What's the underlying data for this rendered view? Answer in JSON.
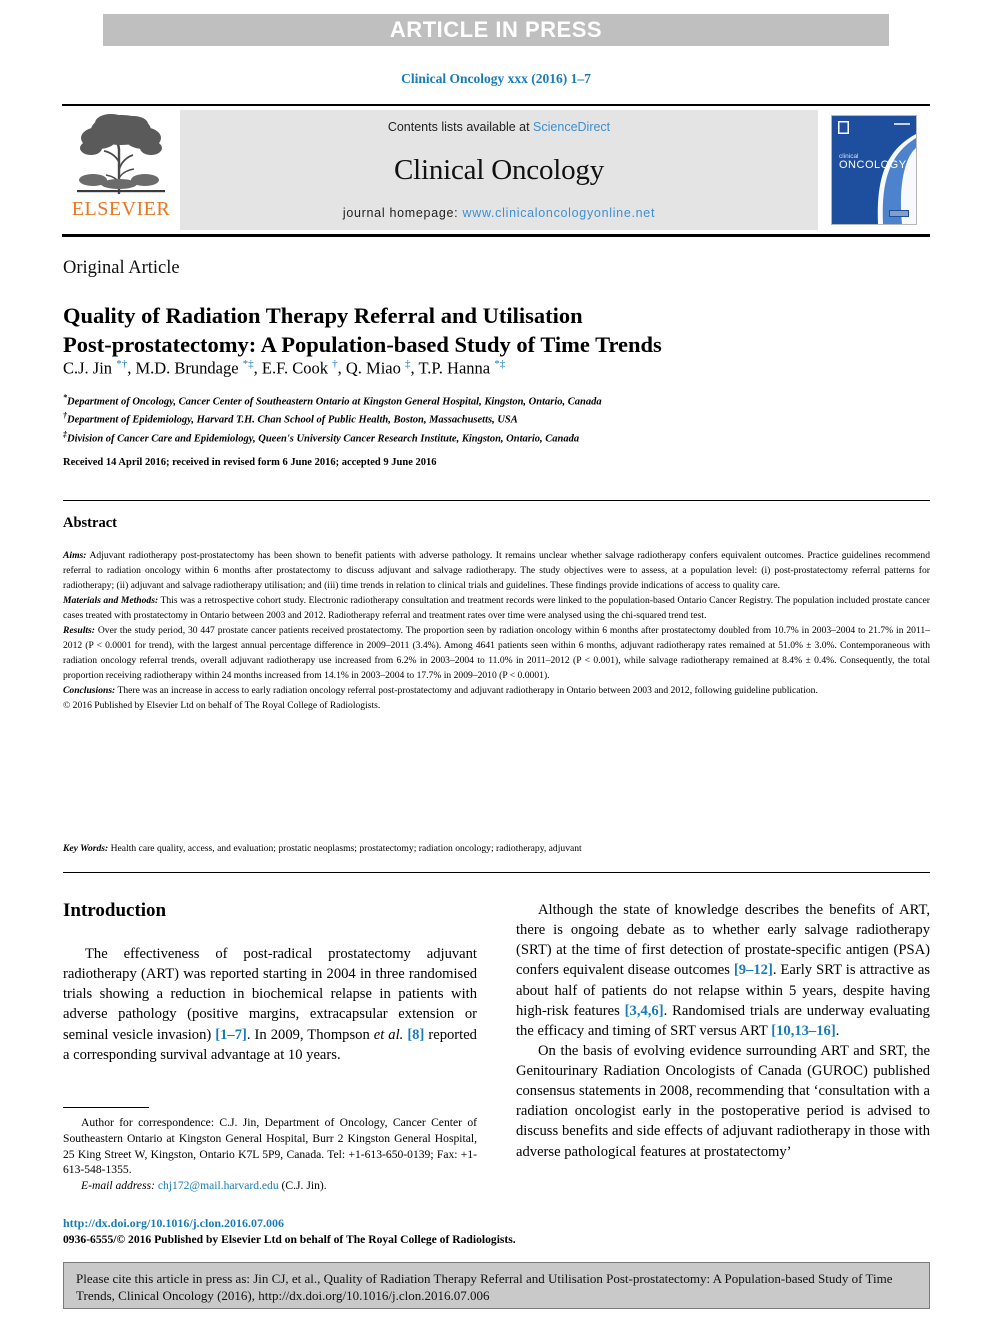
{
  "banner": {
    "text": "ARTICLE IN PRESS"
  },
  "citation": {
    "line": "Clinical Oncology xxx (2016) 1–7"
  },
  "masthead": {
    "publisher_word": "ELSEVIER",
    "contents_prefix": "Contents lists available at ",
    "contents_link": "ScienceDirect",
    "journal_name": "Clinical Oncology",
    "homepage_prefix": "journal homepage: ",
    "homepage_url": "www.clinicaloncologyonline.net",
    "cover_title_small": "clinical",
    "cover_title_large": "ONCOLOGY"
  },
  "article": {
    "type": "Original Article",
    "title_line1": "Quality of Radiation Therapy Referral and Utilisation",
    "title_line2": "Post-prostatectomy: A Population-based Study of Time Trends",
    "authors_html": "C.J. Jin <sup>*†</sup>, M.D. Brundage <sup>*‡</sup>, E.F. Cook <sup>†</sup>, Q. Miao <sup>‡</sup>, T.P. Hanna <sup>*‡</sup>",
    "affiliations": [
      {
        "marker": "*",
        "text": "Department of Oncology, Cancer Center of Southeastern Ontario at Kingston General Hospital, Kingston, Ontario, Canada"
      },
      {
        "marker": "†",
        "text": "Department of Epidemiology, Harvard T.H. Chan School of Public Health, Boston, Massachusetts, USA"
      },
      {
        "marker": "‡",
        "text": "Division of Cancer Care and Epidemiology, Queen's University Cancer Research Institute, Kingston, Ontario, Canada"
      }
    ],
    "history": "Received 14 April 2016; received in revised form 6 June 2016; accepted 9 June 2016"
  },
  "abstract": {
    "heading": "Abstract",
    "aims_label": "Aims:",
    "aims_text": " Adjuvant radiotherapy post-prostatectomy has been shown to benefit patients with adverse pathology. It remains unclear whether salvage radiotherapy confers equivalent outcomes. Practice guidelines recommend referral to radiation oncology within 6 months after prostatectomy to discuss adjuvant and salvage radiotherapy. The study objectives were to assess, at a population level: (i) post-prostatectomy referral patterns for radiotherapy; (ii) adjuvant and salvage radiotherapy utilisation; and (iii) time trends in relation to clinical trials and guidelines. These findings provide indications of access to quality care.",
    "methods_label": "Materials and Methods:",
    "methods_text": " This was a retrospective cohort study. Electronic radiotherapy consultation and treatment records were linked to the population-based Ontario Cancer Registry. The population included prostate cancer cases treated with prostatectomy in Ontario between 2003 and 2012. Radiotherapy referral and treatment rates over time were analysed using the chi-squared trend test.",
    "results_label": "Results:",
    "results_text": " Over the study period, 30 447 prostate cancer patients received prostatectomy. The proportion seen by radiation oncology within 6 months after prostatectomy doubled from 10.7% in 2003–2004 to 21.7% in 2011–2012 (P < 0.0001 for trend), with the largest annual percentage difference in 2009–2011 (3.4%). Among 4641 patients seen within 6 months, adjuvant radiotherapy rates remained at 51.0% ± 3.0%. Contemporaneous with radiation oncology referral trends, overall adjuvant radiotherapy use increased from 6.2% in 2003–2004 to 11.0% in 2011–2012 (P < 0.001), while salvage radiotherapy remained at 8.4% ± 0.4%. Consequently, the total proportion receiving radiotherapy within 24 months increased from 14.1% in 2003–2004 to 17.7% in 2009–2010 (P < 0.0001).",
    "conclusions_label": "Conclusions:",
    "conclusions_text": " There was an increase in access to early radiation oncology referral post-prostatectomy and adjuvant radiotherapy in Ontario between 2003 and 2012, following guideline publication.",
    "copyright": "© 2016 Published by Elsevier Ltd on behalf of The Royal College of Radiologists.",
    "keywords_label": "Key Words:",
    "keywords_text": " Health care quality, access, and evaluation; prostatic neoplasms; prostatectomy; radiation oncology; radiotherapy, adjuvant"
  },
  "body": {
    "intro_heading": "Introduction",
    "left_p1_html": "The effectiveness of post-radical prostatectomy adjuvant radiotherapy (ART) was reported starting in 2004 in three randomised trials showing a reduction in biochemical relapse in patients with adverse pathology (positive margins, extracapsular extension or seminal vesicle invasion) <span class=\"ref\">[1–7]</span>. In 2009, Thompson <i>et al.</i> <span class=\"ref\">[8]</span> reported a corresponding survival advantage at 10 years.",
    "right_p1_html": "Although the state of knowledge describes the benefits of ART, there is ongoing debate as to whether early salvage radiotherapy (SRT) at the time of first detection of prostate-specific antigen (PSA) confers equivalent disease outcomes <span class=\"ref\">[9–12]</span>. Early SRT is attractive as about half of patients do not relapse within 5 years, despite having high-risk features <span class=\"ref\">[3,4,6]</span>. Randomised trials are underway evaluating the efficacy and timing of SRT versus ART <span class=\"ref\">[10,13–16]</span>.",
    "right_p2_html": "On the basis of evolving evidence surrounding ART and SRT, the Genitourinary Radiation Oncologists of Canada (GUROC) published consensus statements in 2008, recommending that ‘consultation with a radiation oncologist early in the postoperative period is advised to discuss benefits and side effects of adjuvant radiotherapy in those with adverse pathological features at prostatectomy’"
  },
  "footnote": {
    "correspondence_html": "Author for correspondence: C.J. Jin, Department of Oncology, Cancer Center of Southeastern Ontario at Kingston General Hospital, Burr 2 Kingston General Hospital, 25 King Street W, Kingston, Ontario K7L 5P9, Canada. Tel: +1-613-650-0139; Fax: +1-613-548-1355.",
    "email_label": "E-mail address:",
    "email": "chj172@mail.harvard.edu",
    "email_suffix": " (C.J. Jin).",
    "doi": "http://dx.doi.org/10.1016/j.clon.2016.07.006",
    "issn": "0936-6555/© 2016 Published by Elsevier Ltd on behalf of The Royal College of Radiologists."
  },
  "cite_box": {
    "text": "Please cite this article in press as: Jin CJ, et al., Quality of Radiation Therapy Referral and Utilisation Post-prostatectomy: A Population-based Study of Time Trends, Clinical Oncology (2016), http://dx.doi.org/10.1016/j.clon.2016.07.006"
  },
  "colors": {
    "link_blue": "#3d8fd1",
    "citation_blue": "#1a7bb9",
    "elsevier_orange": "#e87722",
    "banner_grey": "#bfbfbf",
    "panel_grey": "#e4e4e4",
    "cite_box_grey": "#c9c9c9",
    "cover_blue": "#1d4f9e"
  }
}
